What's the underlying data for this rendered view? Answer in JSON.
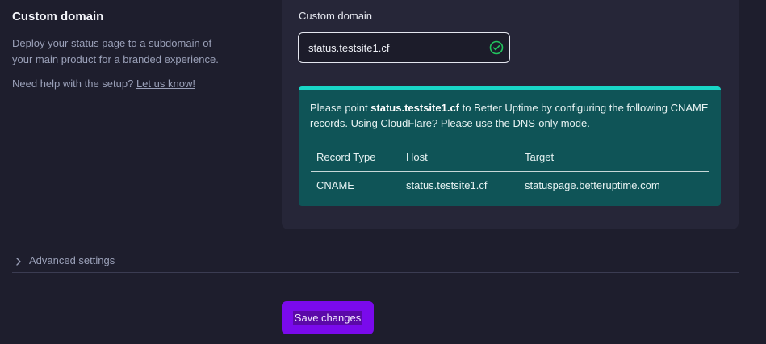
{
  "left": {
    "title": "Custom domain",
    "description": "Deploy your status page to a subdomain of your main product for a branded experience.",
    "help_prefix": "Need help with the setup?",
    "help_link": "Let us know!"
  },
  "card": {
    "field_label": "Custom domain",
    "domain_value": "status.testsite1.cf",
    "check_icon": "check-circle-icon",
    "accent_color": "#19d6c7",
    "info": {
      "text_before": "Please point",
      "domain": "status.testsite1.cf",
      "text_after": "to Better Uptime by configuring the following CNAME records. Using CloudFlare? Please use the DNS-only mode."
    },
    "table": {
      "headers": [
        "Record Type",
        "Host",
        "Target"
      ],
      "rows": [
        [
          "CNAME",
          "status.testsite1.cf",
          "statuspage.betteruptime.com"
        ]
      ]
    }
  },
  "advanced": {
    "label": "Advanced settings",
    "icon": "chevron-right-icon"
  },
  "save_button": {
    "label": "Save changes",
    "color": "#7a0aec"
  }
}
